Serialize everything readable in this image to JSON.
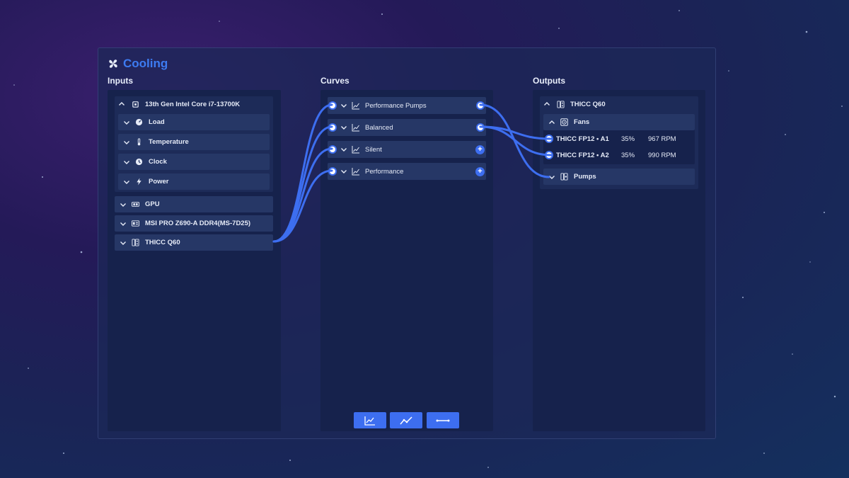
{
  "app": {
    "title": "Cooling"
  },
  "columns": {
    "inputs": "Inputs",
    "curves": "Curves",
    "outputs": "Outputs"
  },
  "inputs": {
    "cpu": {
      "label": "13th Gen Intel Core i7-13700K",
      "children": [
        "Load",
        "Temperature",
        "Clock",
        "Power"
      ]
    },
    "items": [
      "GPU",
      "MSI PRO Z690-A DDR4(MS-7D25)",
      "THICC Q60"
    ]
  },
  "curves": {
    "items": [
      "Performance Pumps",
      "Balanced",
      "Silent",
      "Performance"
    ]
  },
  "outputs": {
    "device": "THICC Q60",
    "fans": {
      "label": "Fans",
      "items": [
        {
          "name": "THICC FP12 • A1",
          "percent": "35%",
          "rpm": "967 RPM"
        },
        {
          "name": "THICC FP12 • A2",
          "percent": "35%",
          "rpm": "990 RPM"
        }
      ]
    },
    "pumps": {
      "label": "Pumps"
    }
  },
  "toolbar": {
    "buttons": [
      "add-graph-curve",
      "add-linear-curve",
      "add-fixed-curve"
    ]
  },
  "colors": {
    "accent": "#3d6ef0",
    "panel": "#16224c",
    "row": "#263766"
  }
}
